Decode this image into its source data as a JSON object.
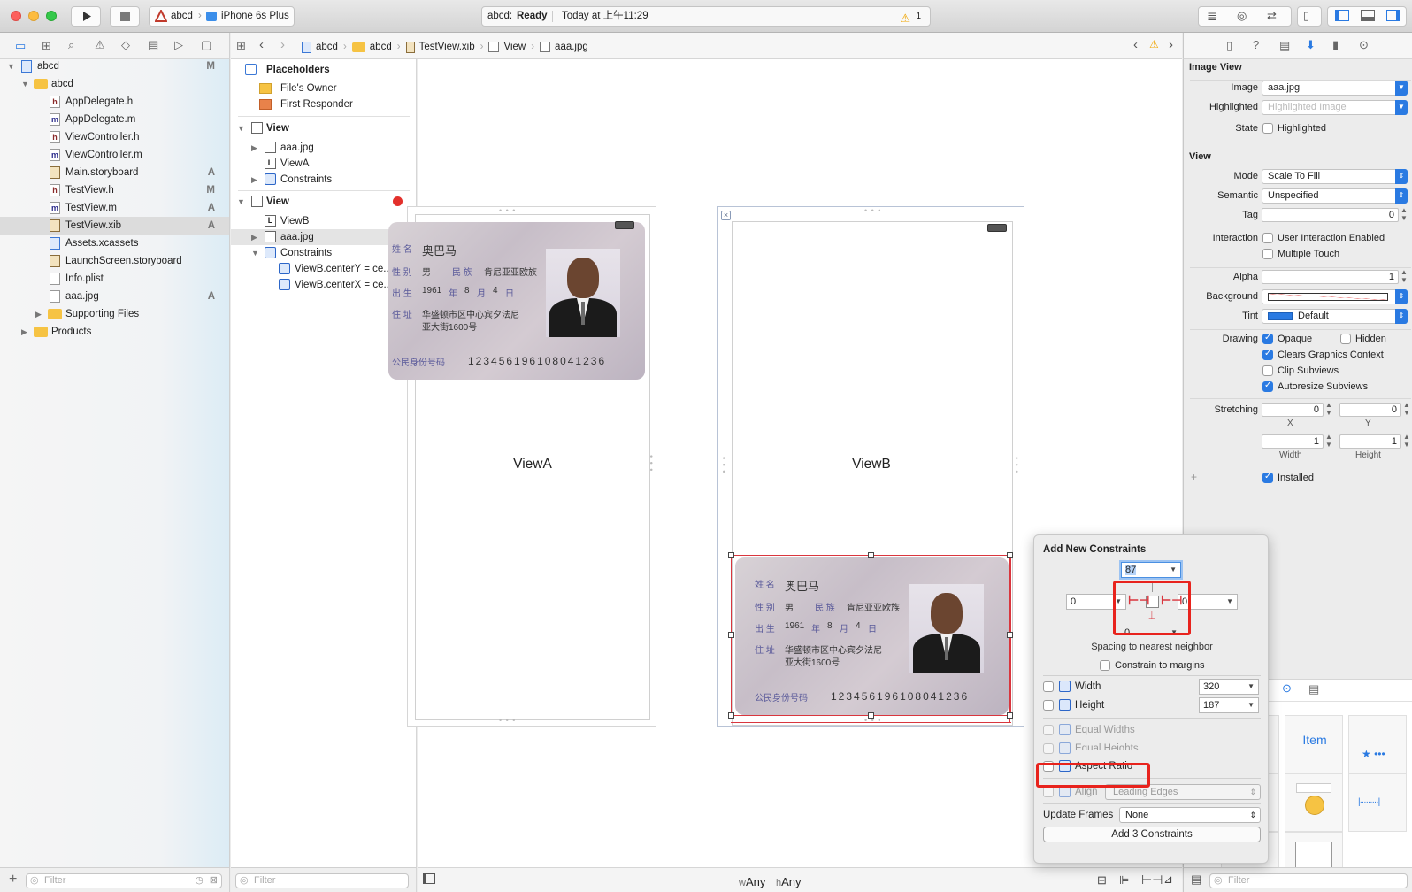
{
  "toolbar": {
    "scheme": "abcd",
    "device": "iPhone 6s Plus",
    "status_project": "abcd:",
    "status_state": "Ready",
    "status_time": "Today at 上午11:29",
    "warning_count": "1"
  },
  "navigator": {
    "items": [
      {
        "label": "abcd",
        "badge": "M",
        "kind": "project",
        "indent": 0,
        "expanded": true
      },
      {
        "label": "abcd",
        "badge": "",
        "kind": "folder",
        "indent": 1,
        "expanded": true
      },
      {
        "label": "AppDelegate.h",
        "badge": "",
        "kind": "h",
        "indent": 2
      },
      {
        "label": "AppDelegate.m",
        "badge": "",
        "kind": "m",
        "indent": 2
      },
      {
        "label": "ViewController.h",
        "badge": "",
        "kind": "h",
        "indent": 2
      },
      {
        "label": "ViewController.m",
        "badge": "",
        "kind": "m",
        "indent": 2
      },
      {
        "label": "Main.storyboard",
        "badge": "A",
        "kind": "sb",
        "indent": 2
      },
      {
        "label": "TestView.h",
        "badge": "M",
        "kind": "h",
        "indent": 2
      },
      {
        "label": "TestView.m",
        "badge": "A",
        "kind": "m",
        "indent": 2
      },
      {
        "label": "TestView.xib",
        "badge": "A",
        "kind": "xib",
        "indent": 2,
        "selected": true
      },
      {
        "label": "Assets.xcassets",
        "badge": "",
        "kind": "assets",
        "indent": 2
      },
      {
        "label": "LaunchScreen.storyboard",
        "badge": "",
        "kind": "sb",
        "indent": 2
      },
      {
        "label": "Info.plist",
        "badge": "",
        "kind": "plist",
        "indent": 2
      },
      {
        "label": "aaa.jpg",
        "badge": "A",
        "kind": "img",
        "indent": 2
      },
      {
        "label": "Supporting Files",
        "badge": "",
        "kind": "folder",
        "indent": 2,
        "collapsed": true
      },
      {
        "label": "Products",
        "badge": "",
        "kind": "folder",
        "indent": 1,
        "collapsed": true
      }
    ],
    "filter_placeholder": "Filter"
  },
  "jumpbar": {
    "crumbs": [
      "abcd",
      "abcd",
      "TestView.xib",
      "View",
      "aaa.jpg"
    ]
  },
  "outline": {
    "placeholders_title": "Placeholders",
    "files_owner": "File's Owner",
    "first_responder": "First Responder",
    "view1": "View",
    "view1_img": "aaa.jpg",
    "view1_label": "ViewA",
    "view1_constraints": "Constraints",
    "view2": "View",
    "view2_label": "ViewB",
    "view2_img": "aaa.jpg",
    "view2_constraints": "Constraints",
    "constraint1": "ViewB.centerY = ce...",
    "constraint2": "ViewB.centerX = ce...",
    "filter_placeholder": "Filter"
  },
  "canvas": {
    "viewA_label": "ViewA",
    "viewB_label": "ViewB",
    "size_class_w": "Any",
    "size_class_h": "Any",
    "size_class_w_prefix": "w",
    "size_class_h_prefix": "h"
  },
  "idcard": {
    "name_label": "姓 名",
    "name": "奥巴马",
    "sex_label": "性 别",
    "sex": "男",
    "nation_label": "民 族",
    "nation": "肯尼亚亚欧族",
    "birth_label": "出 生",
    "birth_year": "1961",
    "birth_year_unit": "年",
    "birth_month": "8",
    "birth_month_unit": "月",
    "birth_day": "4",
    "birth_day_unit": "日",
    "addr_label": "住 址",
    "addr1": "华盛顿市区中心宾夕法尼",
    "addr2": "亚大街1600号",
    "id_label": "公民身份号码",
    "id_number": "123456196108041236"
  },
  "inspector": {
    "image_view_title": "Image View",
    "image_label": "Image",
    "image_value": "aaa.jpg",
    "highlighted_label": "Highlighted",
    "highlighted_placeholder": "Highlighted Image",
    "state_label": "State",
    "state_check": "Highlighted",
    "view_title": "View",
    "mode_label": "Mode",
    "mode_value": "Scale To Fill",
    "semantic_label": "Semantic",
    "semantic_value": "Unspecified",
    "tag_label": "Tag",
    "tag_value": "0",
    "interaction_label": "Interaction",
    "user_interaction": "User Interaction Enabled",
    "multiple_touch": "Multiple Touch",
    "alpha_label": "Alpha",
    "alpha_value": "1",
    "background_label": "Background",
    "tint_label": "Tint",
    "tint_value": "Default",
    "drawing_label": "Drawing",
    "opaque": "Opaque",
    "hidden": "Hidden",
    "clears_context": "Clears Graphics Context",
    "clip_subviews": "Clip Subviews",
    "autoresize_subviews": "Autoresize Subviews",
    "stretching_label": "Stretching",
    "stretch_x": "0",
    "stretch_y": "0",
    "stretch_x_label": "X",
    "stretch_y_label": "Y",
    "stretch_w": "1",
    "stretch_h": "1",
    "width_label": "Width",
    "height_label": "Height",
    "installed": "Installed",
    "tint_color": "#2a7ae2",
    "accent": "#2a7ae2"
  },
  "library": {
    "item_label": "Item",
    "filter_placeholder": "Filter"
  },
  "popover": {
    "title": "Add New Constraints",
    "top_value": "87",
    "left_value": "0",
    "right_value": "0",
    "bottom_value": "0",
    "spacing_note": "Spacing to nearest neighbor",
    "constrain_margins": "Constrain to margins",
    "width_label": "Width",
    "width_value": "320",
    "height_label": "Height",
    "height_value": "187",
    "equal_widths": "Equal Widths",
    "equal_heights": "Equal Heights",
    "aspect_ratio": "Aspect Ratio",
    "align_label": "Align",
    "align_value": "Leading Edges",
    "update_frames_label": "Update Frames",
    "update_frames_value": "None",
    "add_button": "Add 3 Constraints",
    "highlight_color": "#e8231d"
  }
}
